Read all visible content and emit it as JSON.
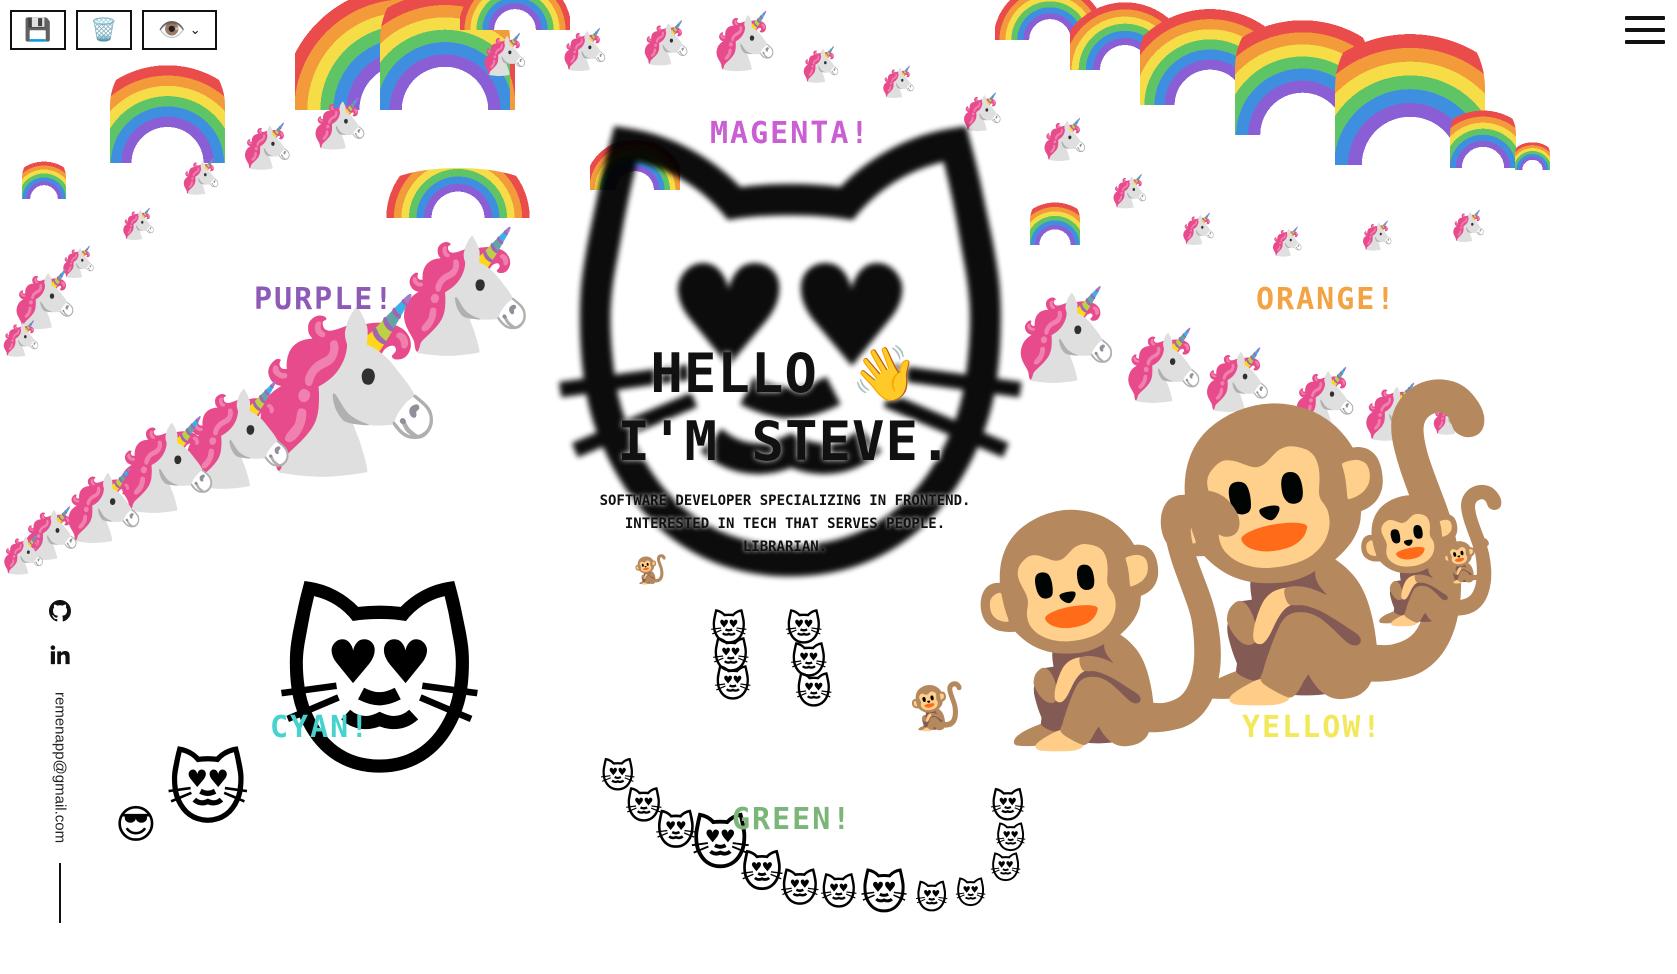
{
  "toolbar": {
    "save_icon": "💾",
    "trash_icon": "🗑️",
    "view_select_value": "👁️",
    "chevron": "⌄"
  },
  "colors": {
    "magenta": "#c95fd2",
    "purple": "#8d5ab8",
    "orange": "#f2a444",
    "cyan": "#46d3cf",
    "yellow": "#f1e85a",
    "green": "#7ab678",
    "text": "#111111"
  },
  "labels": {
    "magenta": "Magenta!",
    "purple": "Purple!",
    "orange": "Orange!",
    "cyan": "Cyan!",
    "yellow": "Yellow!",
    "green": "Green!"
  },
  "hero": {
    "line1": "Hello",
    "wave": "👋",
    "line2": "I'm Steve.",
    "sub": [
      "Software developer specializing in frontend.",
      "Interested in tech that serves people.",
      "Librarian."
    ]
  },
  "social": {
    "github_icon": "github-icon",
    "linkedin_icon": "linkedin-icon",
    "email": "remenapp@gmail.com"
  },
  "emoji": {
    "cat": "😻",
    "cool_cat": "😎",
    "monkey": "🐒",
    "unicorn": "🦄"
  }
}
